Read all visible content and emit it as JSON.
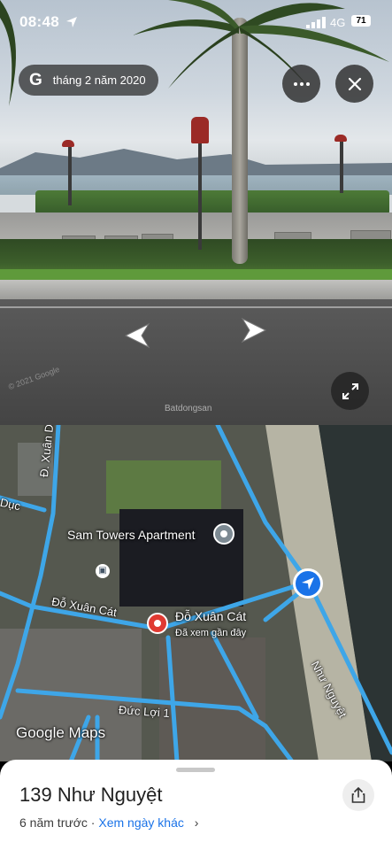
{
  "status_bar": {
    "time": "08:48",
    "network": "4G",
    "battery": "71"
  },
  "street_view": {
    "date_chip": "tháng 2 năm 2020",
    "google_letter": "G",
    "watermark": "© 2021 Google"
  },
  "map": {
    "watermark_brand": "Batdongsan",
    "labels": {
      "xuan_dieu": "Đ. Xuân Diệu",
      "duc": "Dục",
      "do_xuan_cat": "Đỗ Xuân Cát",
      "nhu_nguyet": "Như Nguyệt",
      "duc_loi_1": "Đức Lợi 1"
    },
    "poi": {
      "name": "Sam Towers Apartment"
    },
    "pin": {
      "title": "Đỗ Xuân Cát",
      "subtitle": "Đã xem gần đây"
    },
    "logo": "Google Maps"
  },
  "sheet": {
    "title": "139 Như Nguyệt",
    "age": "6 năm trước",
    "separator": "·",
    "other_dates_link": "Xem ngày khác"
  },
  "colors": {
    "road": "#3ea6e8",
    "pin_red": "#e03a32",
    "link_blue": "#1a73e8"
  }
}
